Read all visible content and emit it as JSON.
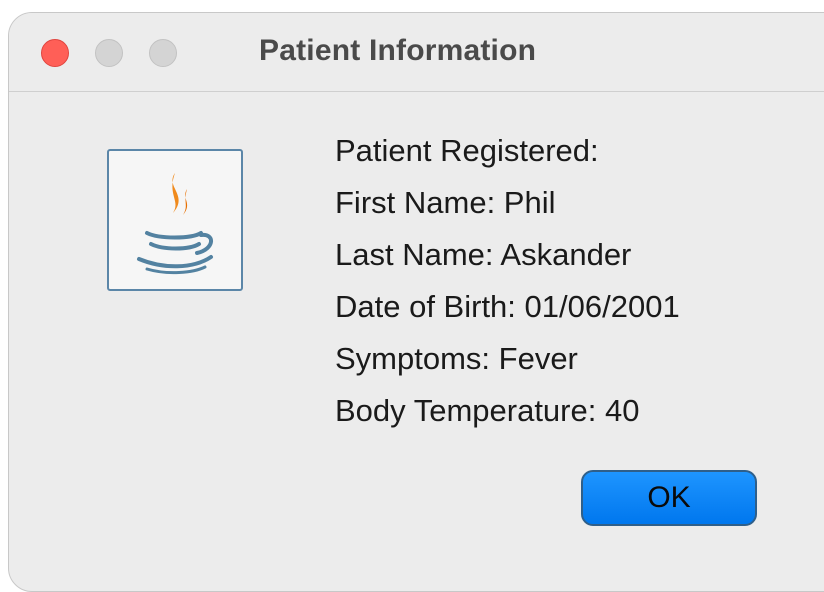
{
  "window": {
    "title": "Patient Information"
  },
  "icon": {
    "name": "java-icon"
  },
  "message": {
    "lines": [
      "Patient Registered:",
      "First Name: Phil",
      "Last Name: Askander",
      "Date of Birth: 01/06/2001",
      "Symptoms: Fever",
      "Body Temperature: 40"
    ]
  },
  "buttons": {
    "ok_label": "OK"
  },
  "colors": {
    "close": "#ff5f57",
    "ok_button": "#0a84ff",
    "icon_border": "#5b86a8"
  }
}
